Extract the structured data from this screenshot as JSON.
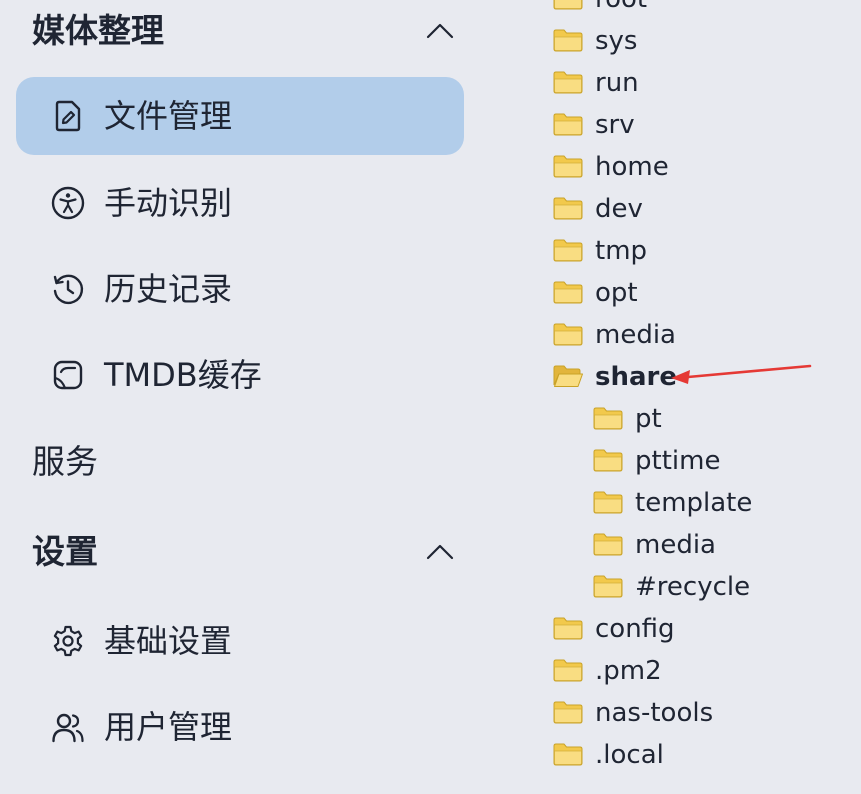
{
  "sidebar": {
    "media_section": {
      "title": "媒体整理",
      "icon": "chevron-up-icon",
      "expanded": true
    },
    "media_items": [
      {
        "label": "文件管理",
        "icon": "file-edit-icon",
        "active": true
      },
      {
        "label": "手动识别",
        "icon": "accessibility-icon",
        "active": false
      },
      {
        "label": "历史记录",
        "icon": "history-icon",
        "active": false
      },
      {
        "label": "TMDB缓存",
        "icon": "sticker-icon",
        "active": false
      }
    ],
    "services_section": {
      "title": "服务"
    },
    "settings_section": {
      "title": "设置",
      "icon": "chevron-up-icon",
      "expanded": true
    },
    "settings_items": [
      {
        "label": "基础设置",
        "icon": "gear-icon"
      },
      {
        "label": "用户管理",
        "icon": "users-icon"
      }
    ]
  },
  "file_tree": {
    "items": [
      {
        "label": "root",
        "level": 0,
        "open": false
      },
      {
        "label": "sys",
        "level": 0,
        "open": false
      },
      {
        "label": "run",
        "level": 0,
        "open": false
      },
      {
        "label": "srv",
        "level": 0,
        "open": false
      },
      {
        "label": "home",
        "level": 0,
        "open": false
      },
      {
        "label": "dev",
        "level": 0,
        "open": false
      },
      {
        "label": "tmp",
        "level": 0,
        "open": false
      },
      {
        "label": "opt",
        "level": 0,
        "open": false
      },
      {
        "label": "media",
        "level": 0,
        "open": false
      },
      {
        "label": "share",
        "level": 0,
        "open": true,
        "highlighted": true
      },
      {
        "label": "pt",
        "level": 1,
        "open": false
      },
      {
        "label": "pttime",
        "level": 1,
        "open": false
      },
      {
        "label": "template",
        "level": 1,
        "open": false
      },
      {
        "label": "media",
        "level": 1,
        "open": false
      },
      {
        "label": "#recycle",
        "level": 1,
        "open": false
      },
      {
        "label": "config",
        "level": 0,
        "open": false
      },
      {
        "label": ".pm2",
        "level": 0,
        "open": false
      },
      {
        "label": "nas-tools",
        "level": 0,
        "open": false
      },
      {
        "label": ".local",
        "level": 0,
        "open": false
      }
    ]
  },
  "colors": {
    "background": "#e8eaf0",
    "active_item": "#b2cdea",
    "text": "#1f2533",
    "annotation_arrow": "#e53935",
    "folder": "#f2c94c"
  }
}
